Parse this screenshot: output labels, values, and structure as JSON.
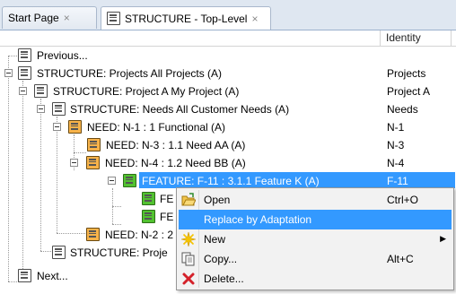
{
  "tabs": [
    {
      "label": "Start Page",
      "close": "×"
    },
    {
      "label": "STRUCTURE - Top-Level",
      "close": "×"
    }
  ],
  "columns": {
    "identity": "Identity"
  },
  "tree": [
    {
      "label": "Previous...",
      "identity": ""
    },
    {
      "label": "STRUCTURE: Projects  All Projects (A)",
      "identity": "Projects"
    },
    {
      "label": "STRUCTURE: Project A  My Project (A)",
      "identity": "Project A"
    },
    {
      "label": "STRUCTURE: Needs  All Customer Needs (A)",
      "identity": "Needs"
    },
    {
      "label": "NEED: N-1 : 1 Functional (A)",
      "identity": "N-1"
    },
    {
      "label": "NEED: N-3 : 1.1 Need AA (A)",
      "identity": "N-3"
    },
    {
      "label": "NEED: N-4 : 1.2 Need BB (A)",
      "identity": "N-4"
    },
    {
      "label": "FEATURE: F-11 : 3.1.1 Feature K (A)",
      "identity": "F-11"
    },
    {
      "label": "FE",
      "identity": ""
    },
    {
      "label": "FE",
      "identity": ""
    },
    {
      "label": "NEED: N-2 : 2",
      "identity": ""
    },
    {
      "label": "STRUCTURE: Proje",
      "identity": ""
    },
    {
      "label": "Next...",
      "identity": ""
    }
  ],
  "context_menu": {
    "items": [
      {
        "label": "Open",
        "shortcut": "Ctrl+O",
        "icon": "folder-open-icon"
      },
      {
        "label": "Replace by Adaptation",
        "shortcut": "",
        "icon": ""
      },
      {
        "label": "New",
        "shortcut": "",
        "icon": "new-star-icon",
        "submenu": "▶"
      },
      {
        "label": "Copy...",
        "shortcut": "Alt+C",
        "icon": "copy-icon"
      },
      {
        "label": "Delete...",
        "shortcut": "",
        "icon": "delete-x-icon"
      }
    ]
  },
  "colors": {
    "selection": "#3399ff",
    "need_icon": "#f7b34a",
    "feature_icon": "#52c230"
  }
}
